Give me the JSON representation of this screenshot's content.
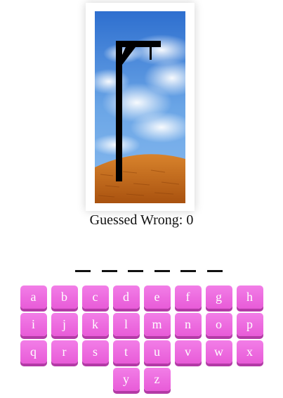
{
  "status": {
    "wrong_label": "Guessed Wrong: 0",
    "wrong_count": 0
  },
  "word": {
    "slots": [
      "",
      "",
      "",
      "",
      "",
      ""
    ]
  },
  "keyboard": {
    "keys": [
      "a",
      "b",
      "c",
      "d",
      "e",
      "f",
      "g",
      "h",
      "i",
      "j",
      "k",
      "l",
      "m",
      "n",
      "o",
      "p",
      "q",
      "r",
      "s",
      "t",
      "u",
      "v",
      "w",
      "x",
      "y",
      "z"
    ],
    "key_color": "#e85bd8",
    "key_shadow_color": "#b33aa6"
  },
  "picture": {
    "scene": "gallows-empty",
    "sky_color": "#4a8ad8",
    "ground_color": "#c26a1c",
    "gallows_color": "#000000"
  }
}
